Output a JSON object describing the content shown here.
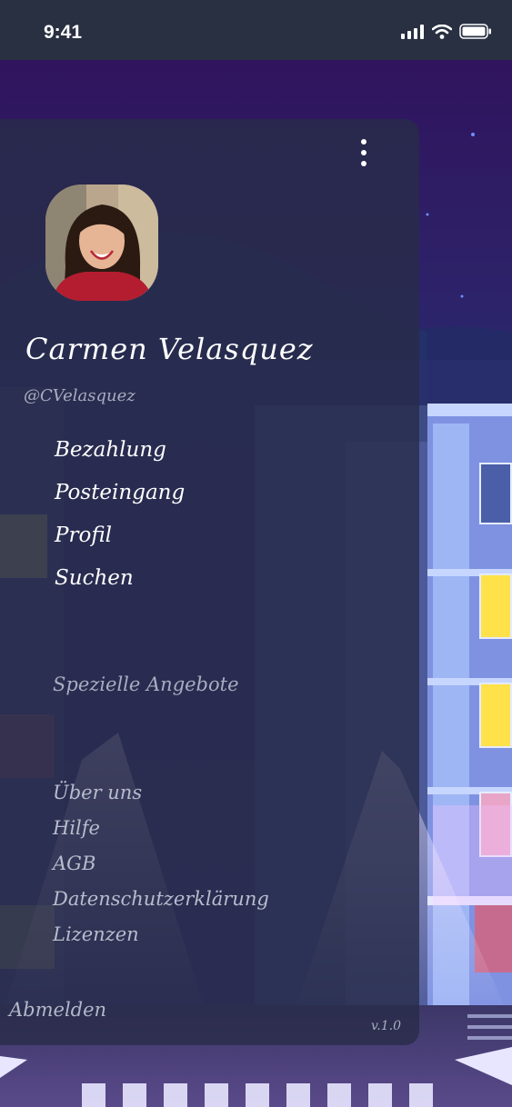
{
  "status_bar": {
    "time": "9:41"
  },
  "drawer": {
    "user_name": "Carmen Velasquez",
    "user_handle": "@CVelasquez",
    "main_items": [
      {
        "label": "Bezahlung"
      },
      {
        "label": "Posteingang"
      },
      {
        "label": "Profil"
      },
      {
        "label": "Suchen"
      }
    ],
    "special_offers": "Spezielle Angebote",
    "footer_items": [
      {
        "label": "Über uns"
      },
      {
        "label": "Hilfe"
      },
      {
        "label": "AGB"
      },
      {
        "label": "Datenschutzerklärung"
      },
      {
        "label": "Lizenzen"
      }
    ],
    "logout": "Abmelden",
    "version": "v.1.0"
  },
  "icons": [
    "cellular-signal-icon",
    "wifi-icon",
    "battery-icon",
    "more-vertical-icon"
  ],
  "colors": {
    "status_bar": "#283042",
    "drawer": "#2c3048",
    "sky": "#2e1d5e",
    "text_primary": "#ffffff",
    "text_muted": "#a9adbf"
  }
}
